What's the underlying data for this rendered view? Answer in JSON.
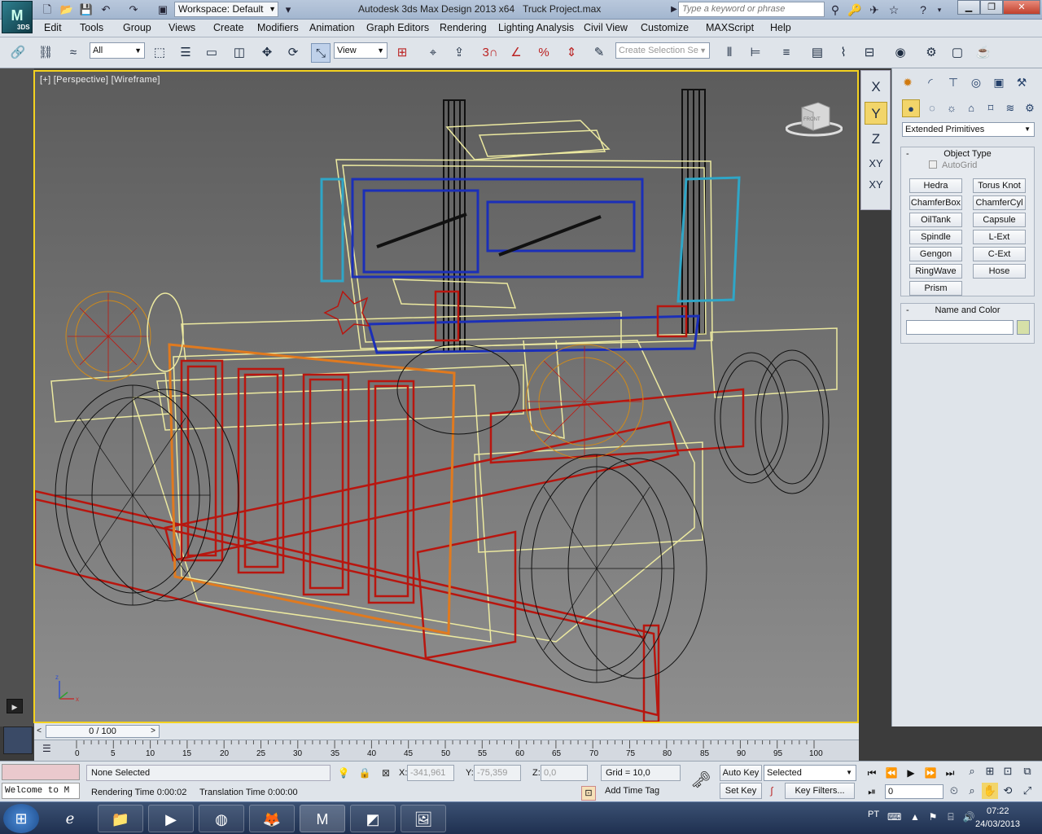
{
  "titlebar": {
    "app_logo": "3DS",
    "workspace": "Workspace: Default",
    "title": "Autodesk 3ds Max Design 2013 x64",
    "file": "Truck Project.max",
    "search_placeholder": "Type a keyword or phrase"
  },
  "menu": [
    "Edit",
    "Tools",
    "Group",
    "Views",
    "Create",
    "Modifiers",
    "Animation",
    "Graph Editors",
    "Rendering",
    "Lighting Analysis",
    "Civil View",
    "Customize",
    "MAXScript",
    "Help"
  ],
  "toolbar": {
    "selection_filter": "All",
    "ref_coord": "View",
    "named_selection_placeholder": "Create Selection Se"
  },
  "viewport": {
    "label": "[+] [Perspective] [Wireframe]",
    "viewcube_label": "FRONT"
  },
  "axis_constraints": [
    "X",
    "Y",
    "Z",
    "XY",
    "XY"
  ],
  "command_panel": {
    "category": "Extended Primitives",
    "object_type_title": "Object Type",
    "autogrid": "AutoGrid",
    "buttons": [
      "Hedra",
      "Torus Knot",
      "ChamferBox",
      "ChamferCyl",
      "OilTank",
      "Capsule",
      "Spindle",
      "L-Ext",
      "Gengon",
      "C-Ext",
      "RingWave",
      "Hose",
      "Prism"
    ],
    "name_color_title": "Name and Color",
    "collapse": "-"
  },
  "timeline": {
    "slider": "0 / 100",
    "prev": "<",
    "next": ">",
    "ticks": [
      "0",
      "5",
      "10",
      "15",
      "20",
      "25",
      "30",
      "35",
      "40",
      "45",
      "50",
      "55",
      "60",
      "65",
      "70",
      "75",
      "80",
      "85",
      "90",
      "95",
      "100"
    ]
  },
  "status": {
    "listener": "Welcome to M",
    "selection": "None Selected",
    "rendering_time": "Rendering Time  0:00:02",
    "translation_time": "Translation Time  0:00:00",
    "x_label": "X:",
    "x_value": "-341,961",
    "y_label": "Y:",
    "y_value": "-75,359",
    "z_label": "Z:",
    "z_value": "0,0",
    "grid": "Grid = 10,0",
    "add_time_tag": "Add Time Tag",
    "auto_key": "Auto Key",
    "set_key": "Set Key",
    "selected": "Selected",
    "key_filters": "Key Filters...",
    "frame": "0"
  },
  "taskbar": {
    "lang": "PT",
    "time": "07:22",
    "date": "24/03/2013"
  }
}
